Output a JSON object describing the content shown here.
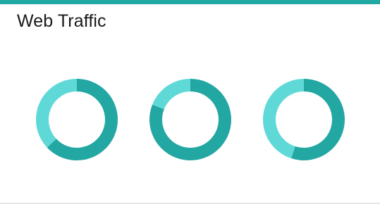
{
  "page": {
    "title": "Web Traffic"
  },
  "colors": {
    "accent_bar": "#20a9a4",
    "primary": "#22a7a3",
    "secondary": "#5fd9d7"
  },
  "chart_data": [
    {
      "type": "pie",
      "variant": "donut",
      "slices": [
        {
          "value": 63
        },
        {
          "value": 37
        }
      ]
    },
    {
      "type": "pie",
      "variant": "donut",
      "slices": [
        {
          "value": 81
        },
        {
          "value": 19
        }
      ]
    },
    {
      "type": "pie",
      "variant": "donut",
      "slices": [
        {
          "value": 55
        },
        {
          "value": 45
        }
      ]
    }
  ]
}
